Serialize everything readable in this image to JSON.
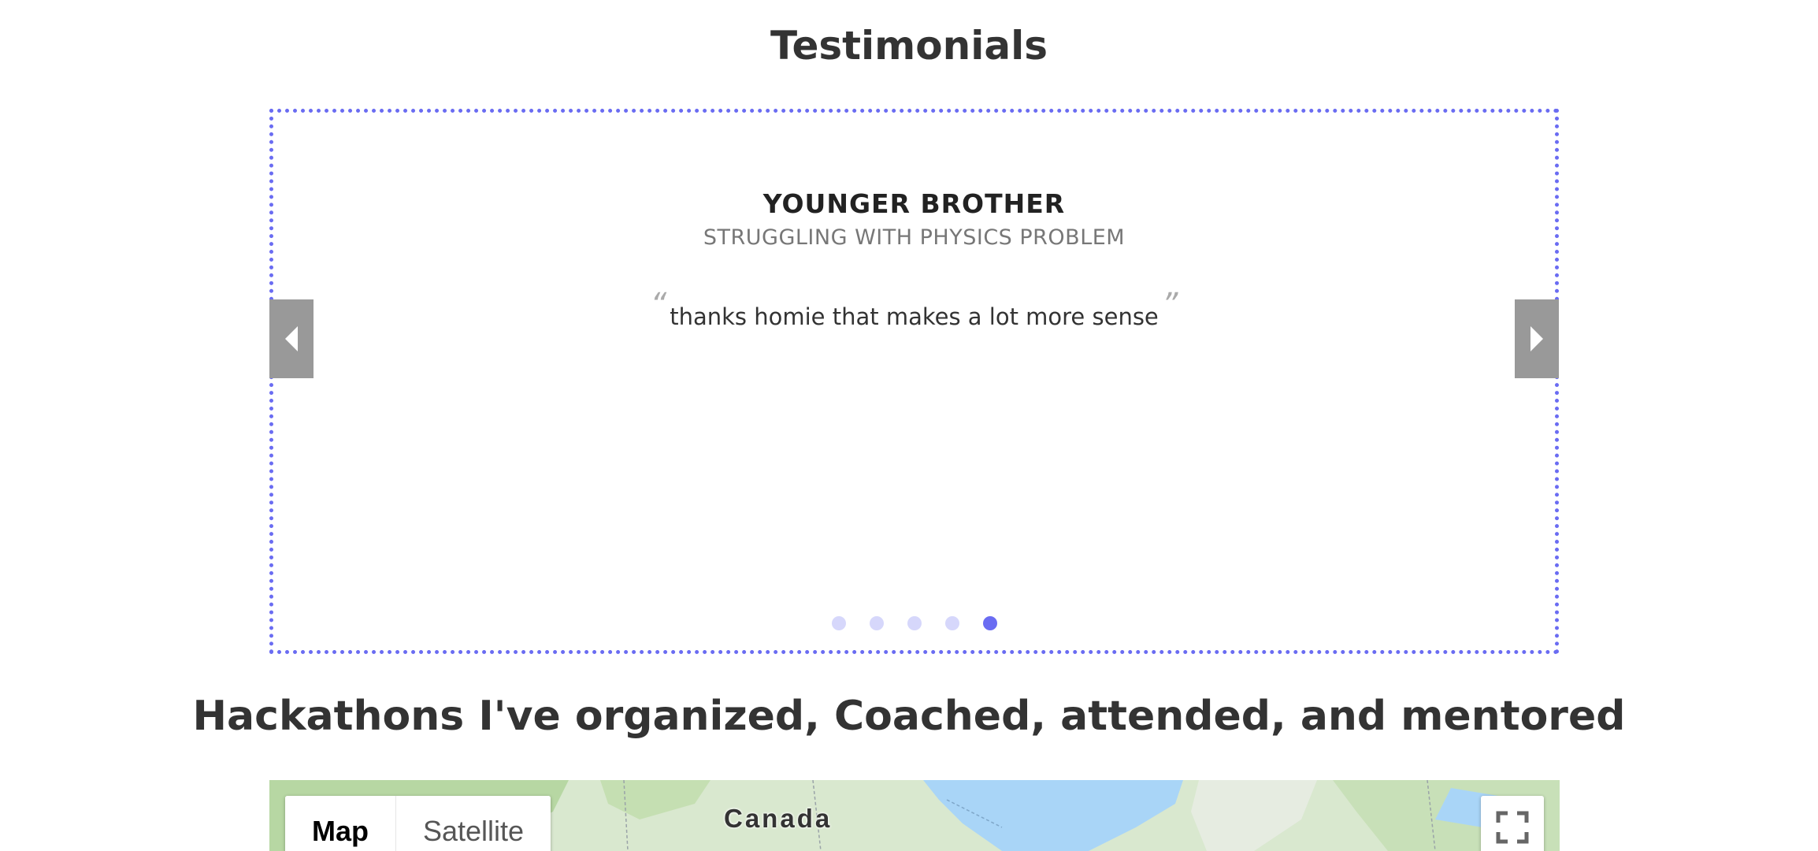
{
  "testimonials": {
    "title": "Testimonials",
    "active_slide": {
      "name": "YOUNGER BROTHER",
      "role": "STRUGGLING WITH PHYSICS PROBLEM",
      "quote": "thanks homie that makes a lot more sense",
      "open_quote": "“",
      "close_quote": "”"
    },
    "nav": {
      "prev_icon": "triangle-left-icon",
      "next_icon": "triangle-right-icon"
    },
    "pagination": {
      "total": 5,
      "active_index": 4
    },
    "colors": {
      "accent": "#6a6cf2",
      "dot_inactive": "#d6d7fb",
      "arrow_bg": "#999999"
    }
  },
  "hackathons": {
    "title": "Hackathons I've organized, Coached, attended, and mentored"
  },
  "map": {
    "type_controls": [
      "Map",
      "Satellite"
    ],
    "selected_type": "Map",
    "place_label": "Canada",
    "fullscreen_icon": "fullscreen-icon",
    "colors": {
      "land": "#d9e8cf",
      "forest": "#b7d7a3",
      "water": "#a9d5f7"
    }
  }
}
